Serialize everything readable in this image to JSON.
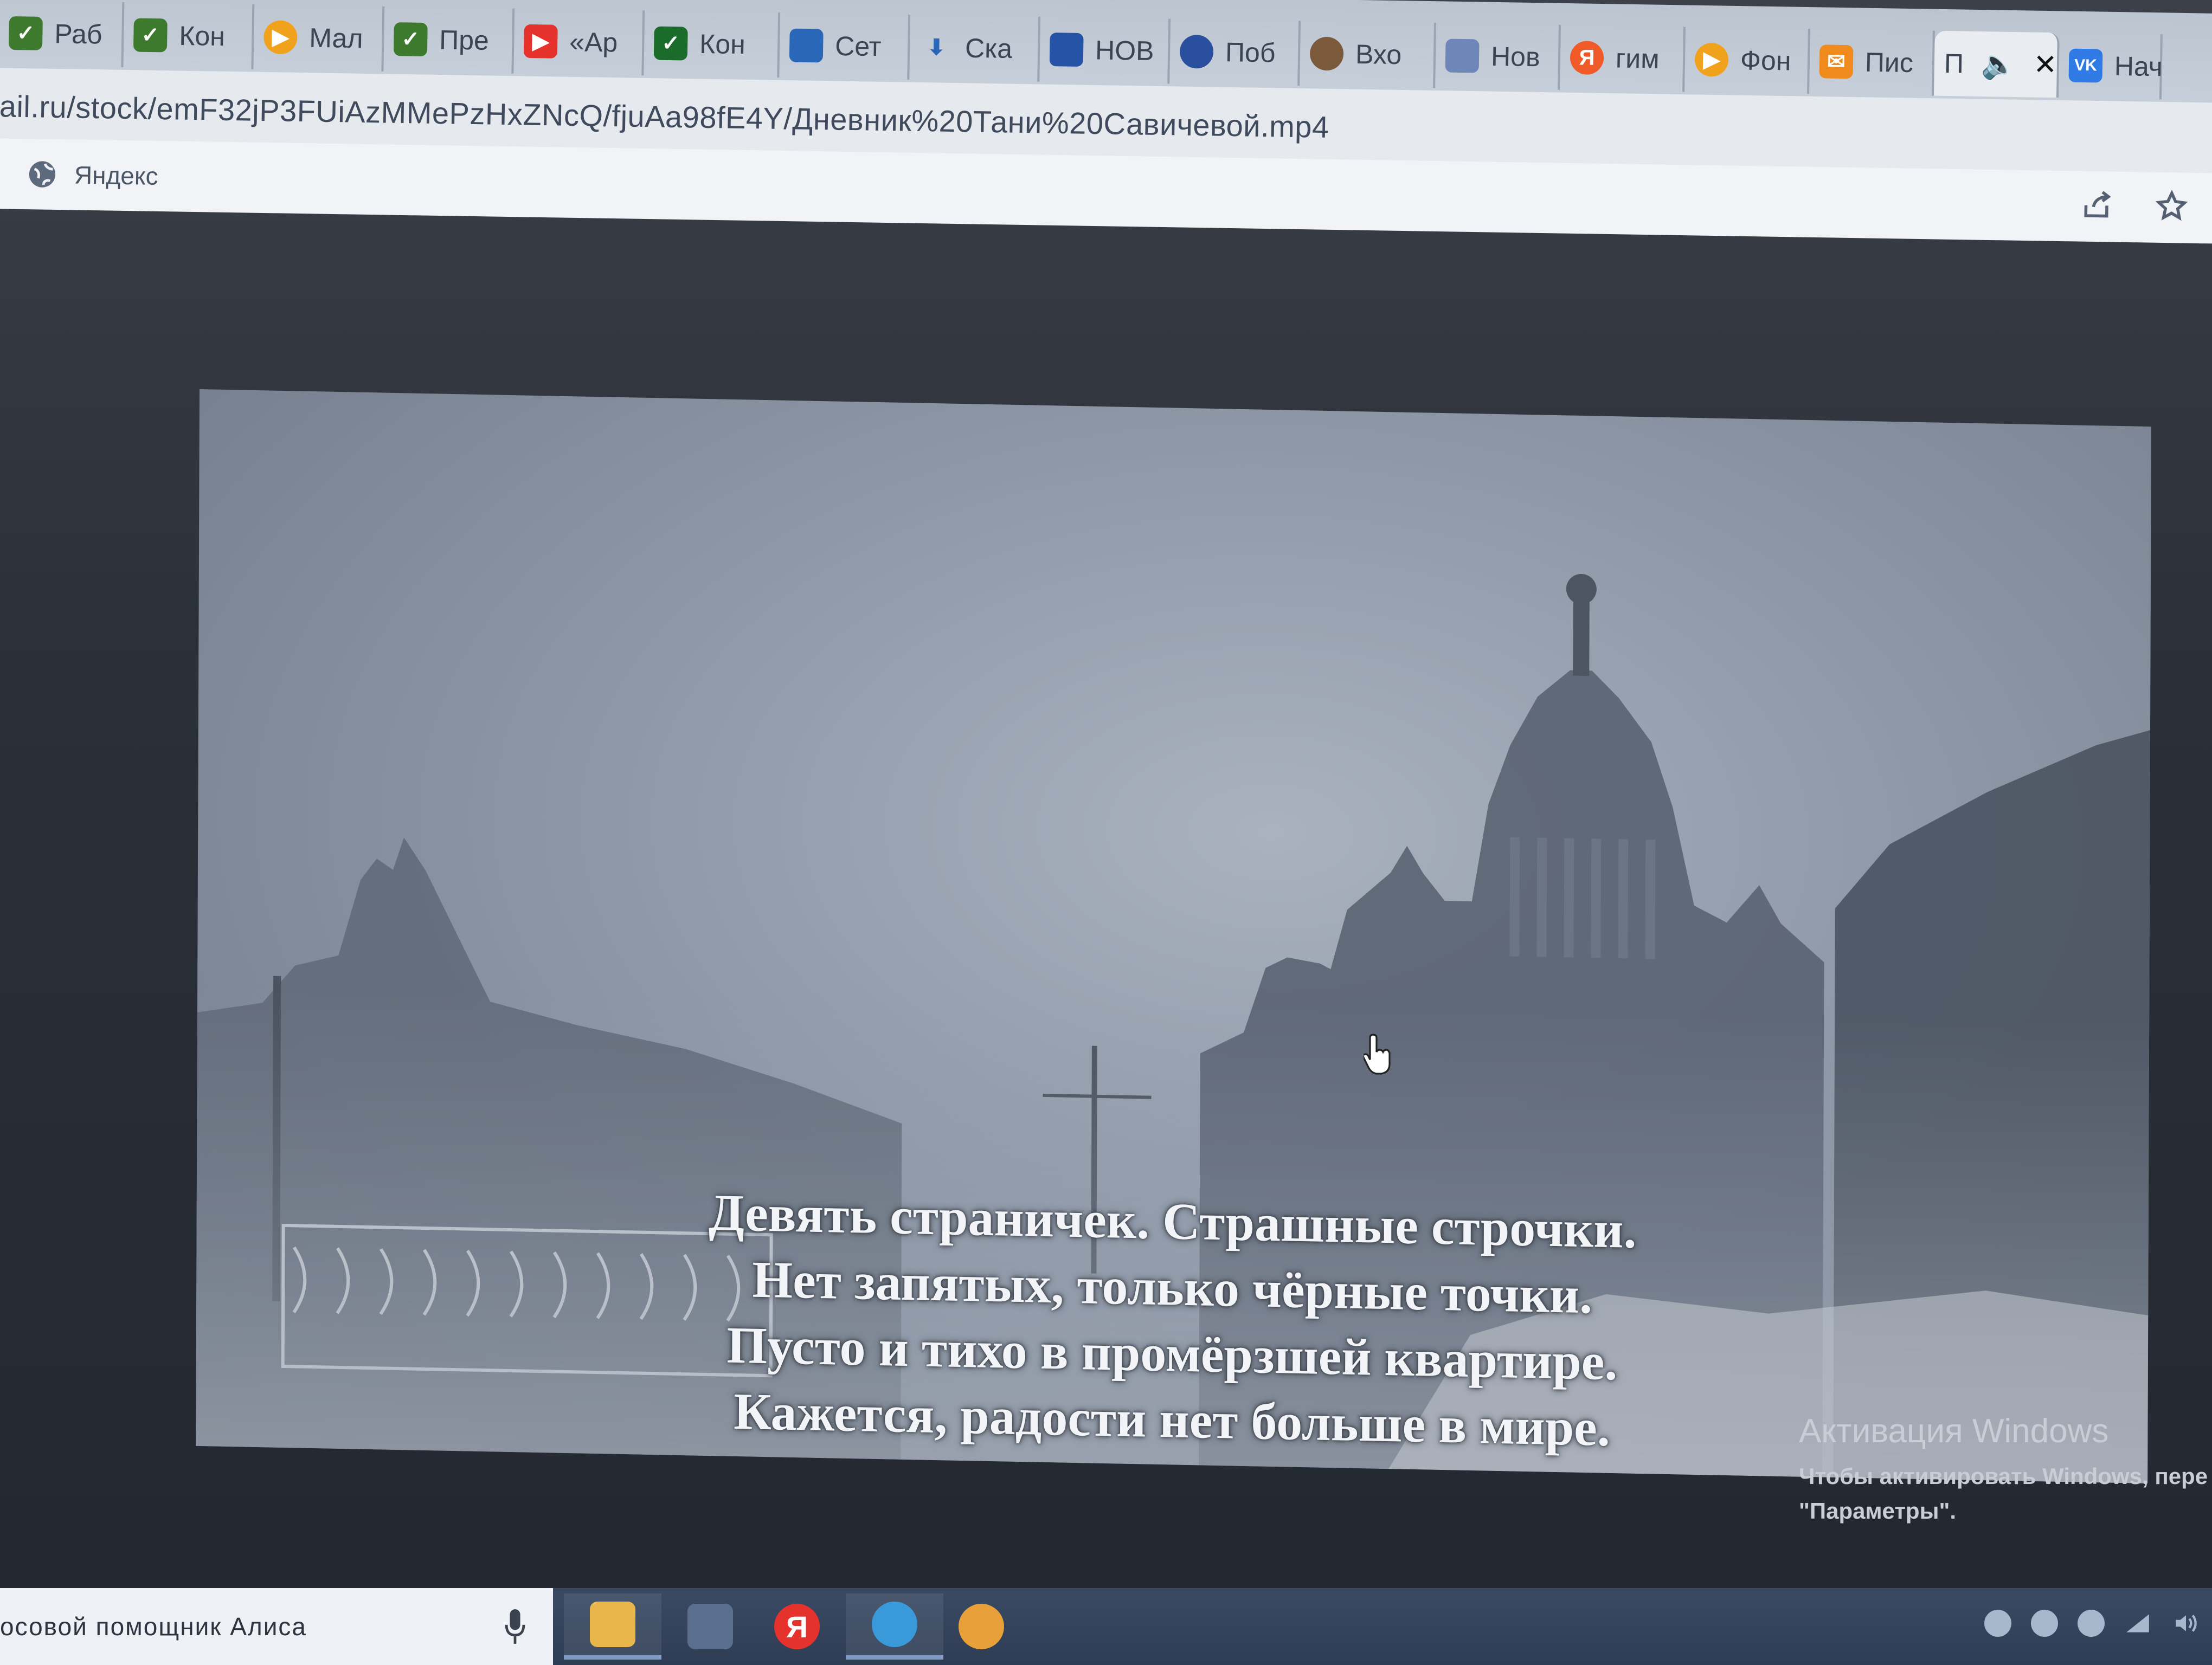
{
  "browser": {
    "tabs": [
      {
        "label": "Раб",
        "icon": "check-icon",
        "color": "#3d7a2e"
      },
      {
        "label": "Кон",
        "icon": "check-icon",
        "color": "#3d7a2e"
      },
      {
        "label": "Мал",
        "icon": "play-icon",
        "color": "#f0a21c"
      },
      {
        "label": "Пре",
        "icon": "check-icon",
        "color": "#3d7a2e"
      },
      {
        "label": "«Ар",
        "icon": "youtube-icon",
        "color": "#e5322d"
      },
      {
        "label": "Кон",
        "icon": "check-icon",
        "color": "#1b6b2a"
      },
      {
        "label": "Сет",
        "icon": "grid-icon",
        "color": "#2b67b8"
      },
      {
        "label": "Ска",
        "icon": "download-icon",
        "color": "#2b67b8"
      },
      {
        "label": "НОВ",
        "icon": "wave-icon",
        "color": "#2553a6"
      },
      {
        "label": "Поб",
        "icon": "circle-icon",
        "color": "#2a4f9e"
      },
      {
        "label": "Вхо",
        "icon": "avatar-icon",
        "color": "#7a5a3a"
      },
      {
        "label": "Нов",
        "icon": "emblem-icon",
        "color": "#6f86b8"
      },
      {
        "label": "гим",
        "icon": "yandex-icon",
        "color": "#f05a28"
      },
      {
        "label": "Фон",
        "icon": "play-icon",
        "color": "#f0a21c"
      },
      {
        "label": "Пис",
        "icon": "mail-icon",
        "color": "#f08a1c"
      },
      {
        "label": "П",
        "icon": "",
        "color": "",
        "active": true
      },
      {
        "label": "Нач",
        "icon": "vk-icon",
        "color": "#2f7ae5"
      }
    ],
    "vk_text": "VK",
    "yandex_letter": "Я",
    "mute_glyph": "🔈",
    "close_glyph": "✕",
    "url": "ail.ru/stock/emF32jP3FUiAzMMePzHxZNcQ/fjuAa98fE4Y/Дневник%20Тани%20Савичевой.mp4",
    "bookmarks": {
      "yandex_label": "Яндекс"
    }
  },
  "video": {
    "subtitles": [
      "Девять страничек. Страшные строчки.",
      "Нет запятых, только чёрные точки.",
      "Пусто и тихо в промёрзшей квартире.",
      "Кажется, радости нет больше в мире."
    ]
  },
  "watermark": {
    "title": "Активация Windows",
    "line1": "Чтобы активировать Windows, пере",
    "line2": "\"Параметры\"."
  },
  "taskbar": {
    "search_text": "осовой помощник Алиса",
    "apps": [
      {
        "name": "explorer",
        "color": "#e8b64a",
        "running": true
      },
      {
        "name": "notepad",
        "color": "#5a6f8e",
        "running": false
      },
      {
        "name": "yandex-browser",
        "color": "#e5322d",
        "running": false,
        "letter": "Я"
      },
      {
        "name": "telegram",
        "color": "#3a9ad9",
        "running": true
      },
      {
        "name": "chrome",
        "color": "#e8a13a",
        "running": false
      }
    ]
  }
}
